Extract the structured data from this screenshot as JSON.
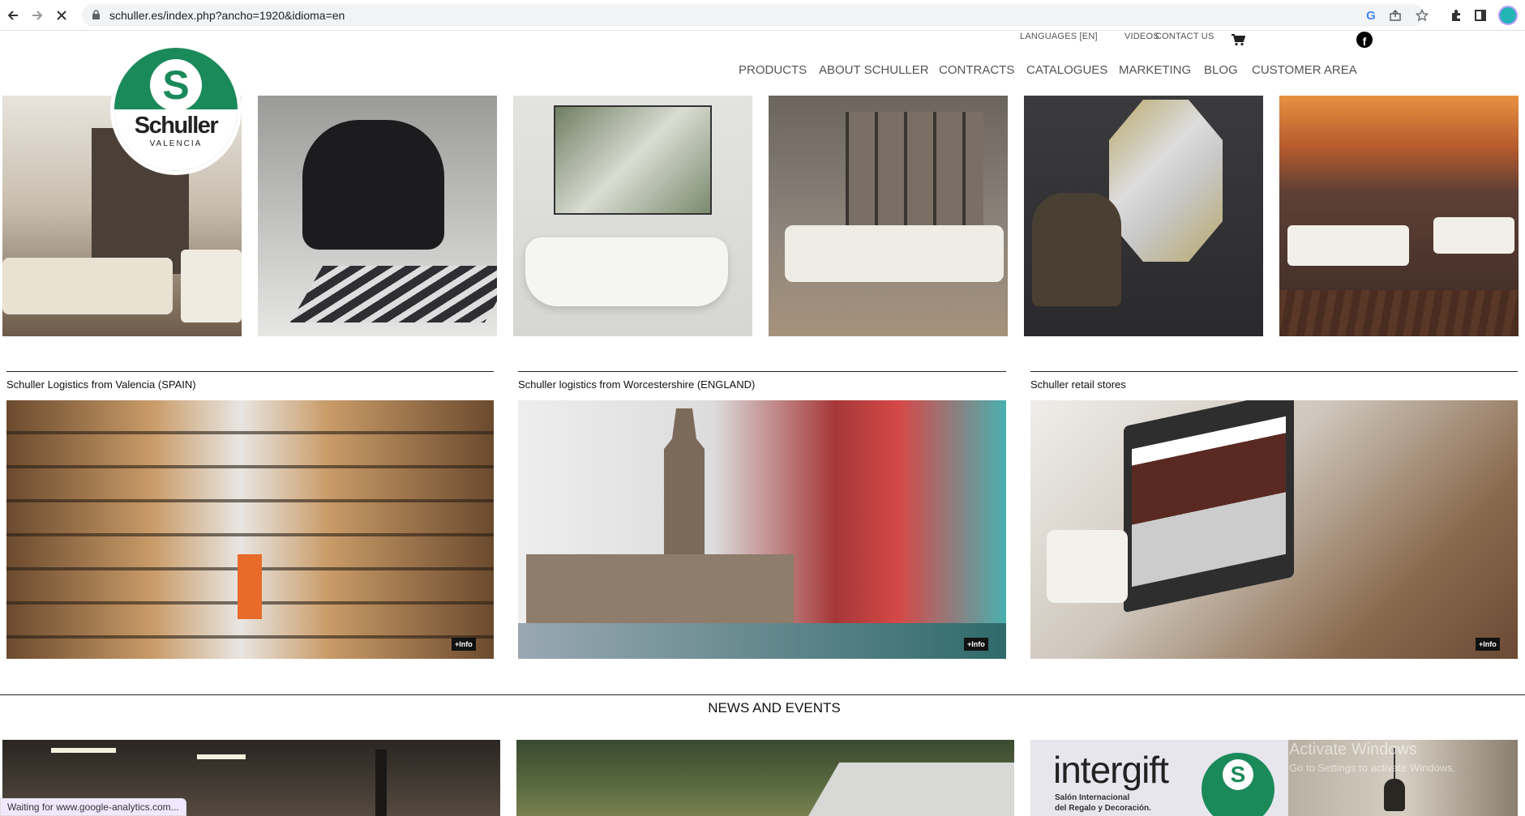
{
  "browser": {
    "url": "schuller.es/index.php?ancho=1920&idioma=en",
    "status": "Waiting for www.google-analytics.com..."
  },
  "topnav": {
    "languages": "LANGUAGES [EN]",
    "videos": "VIDEOS",
    "contact": "CONTACT US"
  },
  "mainnav": [
    "PRODUCTS",
    "ABOUT SCHULLER",
    "CONTRACTS",
    "CATALOGUES",
    "MARKETING",
    "BLOG",
    "CUSTOMER AREA"
  ],
  "logo": {
    "wordmark": "Schuller",
    "sub": "VALENCIA",
    "glyph": "S"
  },
  "sections": [
    {
      "label": "Schuller Logistics from Valencia (SPAIN)",
      "badge": "+Info"
    },
    {
      "label": "Schuller logistics from Worcestershire (ENGLAND)",
      "badge": "+Info"
    },
    {
      "label": "Schuller retail stores",
      "badge": "+Info"
    }
  ],
  "news": {
    "title": "NEWS AND EVENTS",
    "intergift": {
      "brand": "intergift",
      "line1": "Salón Internacional",
      "line2": "del Regalo y Decoración."
    }
  },
  "overlay": {
    "activate": "Activate Windows",
    "settings": "Go to Settings to activate Windows."
  },
  "colors": {
    "brand_green": "#1b8a5a"
  }
}
